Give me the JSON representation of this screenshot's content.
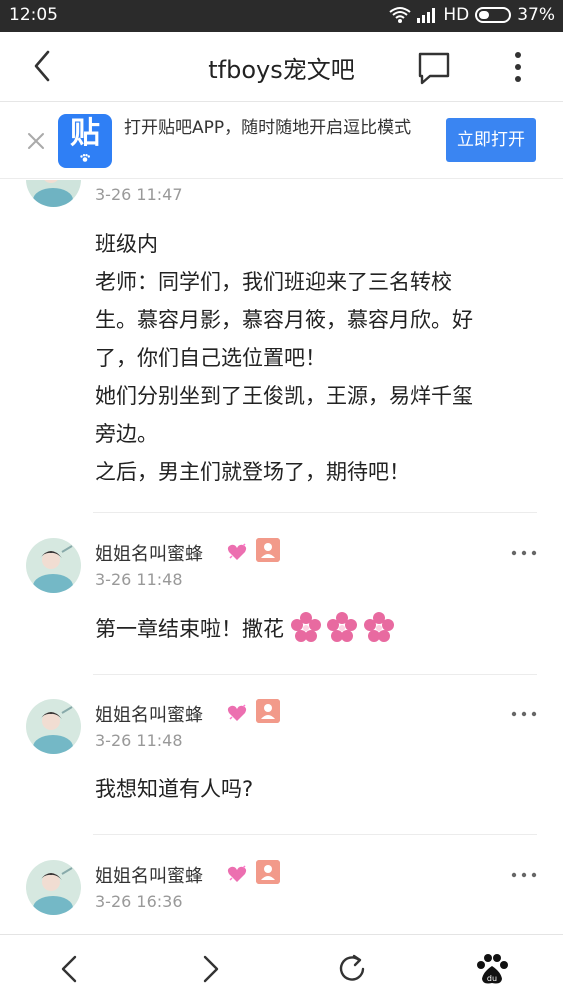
{
  "status_bar": {
    "time": "12:05",
    "network_label": "HD",
    "battery_percent": "37%",
    "battery_level": 0.37
  },
  "header": {
    "title": "tfboys宠文吧",
    "icons": [
      "back-arrow-icon",
      "comment-icon",
      "more-vertical-icon"
    ]
  },
  "banner": {
    "logo_text": "贴",
    "message": "打开贴吧APP，随时随地开启逗比模式",
    "open_label": "立即打开"
  },
  "posts": [
    {
      "timestamp": "3-26 11:47",
      "lines": [
        "班级内",
        "老师：同学们，我们班迎来了三名转校",
        "生。慕容月影，慕容月筱，慕容月欣。好",
        "了，你们自己选位置吧！",
        "她们分别坐到了王俊凯，王源，易烊千玺",
        "旁边。",
        "之后，男主们就登场了，期待吧！"
      ]
    },
    {
      "username": "姐姐名叫蜜蜂",
      "timestamp": "3-26 11:48",
      "text": "第一章结束啦！撒花",
      "emoji_count": 3
    },
    {
      "username": "姐姐名叫蜜蜂",
      "timestamp": "3-26 11:48",
      "text": "我想知道有人吗?"
    },
    {
      "username": "姐姐名叫蜜蜂",
      "timestamp": "3-26 16:36"
    }
  ],
  "bottom_nav": {
    "icons": [
      "back-icon",
      "forward-icon",
      "refresh-icon",
      "baidu-paw-icon"
    ]
  },
  "colors": {
    "accent_blue": "#3a85f2",
    "badge_pink": "#f29a8a",
    "flower_pink": "#e86aa0",
    "status_bar_bg": "#2b2b2b"
  }
}
